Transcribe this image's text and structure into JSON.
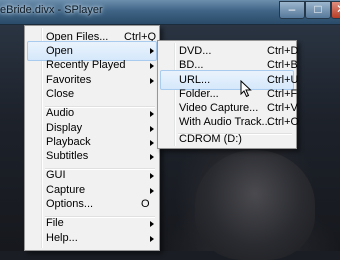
{
  "window": {
    "title": "eBride.divx - SPlayer",
    "min_glyph": "–",
    "max_glyph": "□",
    "close_glyph": "✕"
  },
  "main_menu": {
    "items": [
      {
        "label": "Open Files...",
        "shortcut": "Ctrl+Q"
      },
      {
        "label": "Open",
        "arrow": true
      },
      {
        "label": "Recently Played",
        "arrow": true
      },
      {
        "label": "Favorites",
        "arrow": true
      },
      {
        "label": "Close"
      },
      {
        "label": "Audio",
        "arrow": true
      },
      {
        "label": "Display",
        "arrow": true
      },
      {
        "label": "Playback",
        "arrow": true
      },
      {
        "label": "Subtitles",
        "arrow": true
      },
      {
        "label": "GUI",
        "arrow": true
      },
      {
        "label": "Capture",
        "arrow": true
      },
      {
        "label": "Options...",
        "shortcut": "O"
      },
      {
        "label": "File",
        "arrow": true
      },
      {
        "label": "Help...",
        "arrow": true
      }
    ]
  },
  "open_submenu": {
    "items": [
      {
        "label": "DVD...",
        "shortcut": "Ctrl+D"
      },
      {
        "label": "BD...",
        "shortcut": "Ctrl+B"
      },
      {
        "label": "URL...",
        "shortcut": "Ctrl+U"
      },
      {
        "label": "Folder...",
        "shortcut": "Ctrl+F"
      },
      {
        "label": "Video Capture...",
        "shortcut": "Ctrl+V"
      },
      {
        "label": "With Audio Track...",
        "shortcut": "Ctrl+O"
      },
      {
        "label": "CDROM  (D:)"
      }
    ]
  },
  "colors": {
    "menu_bg": "#f1f1f1",
    "highlight_bg": "#d5e8fb",
    "highlight_border": "#a9cbee",
    "title_bar": "#3f6485"
  },
  "icons": [
    "submenu-arrow-icon",
    "mouse-cursor-icon",
    "minimize-icon",
    "maximize-icon",
    "close-icon"
  ]
}
